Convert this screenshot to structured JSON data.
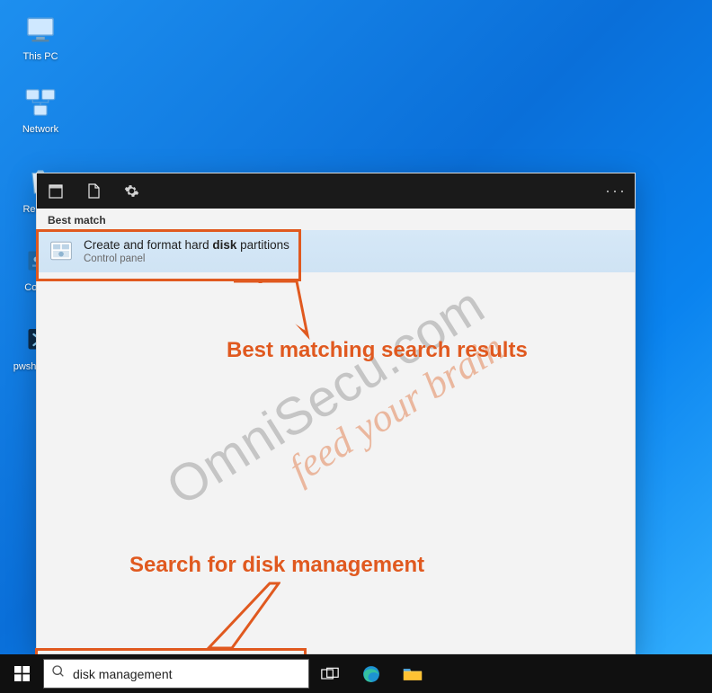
{
  "desktop": {
    "icons": [
      {
        "name": "this-pc",
        "label": "This PC"
      },
      {
        "name": "network",
        "label": "Network"
      },
      {
        "name": "recycle-bin",
        "label": "Recycle"
      },
      {
        "name": "control-panel",
        "label": "Control"
      },
      {
        "name": "pwsh",
        "label": "pwsh Shortc"
      }
    ]
  },
  "searchPanel": {
    "sectionLabel": "Best match",
    "bestMatch": {
      "title_pre": "Create and format hard ",
      "title_bold": "disk",
      "title_post": " partitions",
      "subtitle": "Control panel"
    },
    "moreLabel": "···"
  },
  "annotations": {
    "top": "Best matching search results",
    "bottom": "Search for disk management"
  },
  "watermark": {
    "line1": "OmniSecu.com",
    "line2": "feed your brain"
  },
  "taskbar": {
    "searchValue": "disk management"
  },
  "colors": {
    "accent": "#e0591f"
  }
}
